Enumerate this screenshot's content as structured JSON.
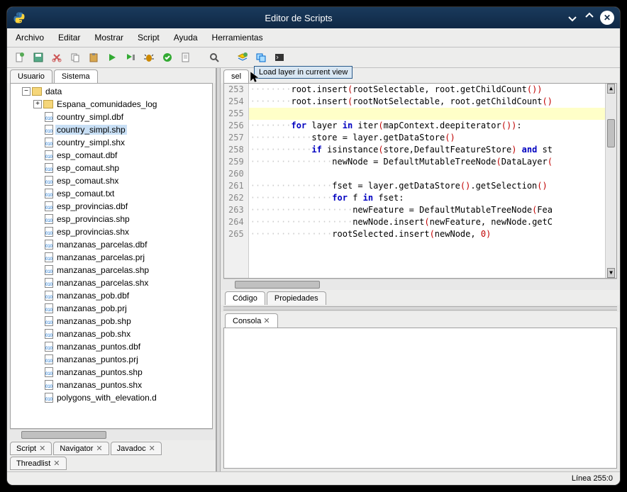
{
  "window": {
    "title": "Editor de Scripts"
  },
  "menu": {
    "items": [
      "Archivo",
      "Editar",
      "Mostrar",
      "Script",
      "Ayuda",
      "Herramientas"
    ]
  },
  "tooltip": "Load layer in current view",
  "leftTabs": {
    "top": [
      "Usuario",
      "Sistema"
    ],
    "activeTop": 1
  },
  "tree": {
    "root": "data",
    "subfolder": "Espana_comunidades_log",
    "files": [
      "country_simpl.dbf",
      "country_simpl.shp",
      "country_simpl.shx",
      "esp_comaut.dbf",
      "esp_comaut.shp",
      "esp_comaut.shx",
      "esp_comaut.txt",
      "esp_provincias.dbf",
      "esp_provincias.shp",
      "esp_provincias.shx",
      "manzanas_parcelas.dbf",
      "manzanas_parcelas.prj",
      "manzanas_parcelas.shp",
      "manzanas_parcelas.shx",
      "manzanas_pob.dbf",
      "manzanas_pob.prj",
      "manzanas_pob.shp",
      "manzanas_pob.shx",
      "manzanas_puntos.dbf",
      "manzanas_puntos.prj",
      "manzanas_puntos.shp",
      "manzanas_puntos.shx",
      "polygons_with_elevation.d"
    ],
    "selected": "country_simpl.shp"
  },
  "leftBottomTabs": [
    "Script",
    "Navigator",
    "Javadoc",
    "Threadlist"
  ],
  "codeTab": "sel",
  "gutterStart": 253,
  "gutterEnd": 265,
  "code": {
    "lines": [
      {
        "n": 253,
        "dots": 8,
        "t": [
          [
            "",
            "root.insert"
          ],
          [
            "paren",
            "("
          ],
          [
            "",
            "rootSelectable, root.getChildCount"
          ],
          [
            "paren",
            "())"
          ]
        ]
      },
      {
        "n": 254,
        "dots": 8,
        "t": [
          [
            "",
            "root.insert"
          ],
          [
            "paren",
            "("
          ],
          [
            "",
            "rootNotSelectable, root.getChildCount"
          ],
          [
            "paren",
            "()"
          ]
        ]
      },
      {
        "n": 255,
        "hl": true,
        "dots": 0,
        "t": []
      },
      {
        "n": 256,
        "dots": 8,
        "t": [
          [
            "kw",
            "for"
          ],
          [
            "",
            " layer "
          ],
          [
            "kw",
            "in"
          ],
          [
            "",
            " iter"
          ],
          [
            "paren",
            "("
          ],
          [
            "",
            "mapContext.deepiterator"
          ],
          [
            "paren",
            "())"
          ],
          [
            "",
            ":"
          ]
        ]
      },
      {
        "n": 257,
        "dots": 12,
        "t": [
          [
            "",
            "store = layer.getDataStore"
          ],
          [
            "paren",
            "()"
          ]
        ]
      },
      {
        "n": 258,
        "dots": 12,
        "t": [
          [
            "kw",
            "if"
          ],
          [
            "",
            " isinstance"
          ],
          [
            "paren",
            "("
          ],
          [
            "",
            "store,DefaultFeatureStore"
          ],
          [
            "paren",
            ")"
          ],
          [
            "",
            " "
          ],
          [
            "kw",
            "and"
          ],
          [
            "",
            " st"
          ]
        ]
      },
      {
        "n": 259,
        "dots": 16,
        "t": [
          [
            "",
            "newNode = DefaultMutableTreeNode"
          ],
          [
            "paren",
            "("
          ],
          [
            "",
            "DataLayer"
          ],
          [
            "paren",
            "("
          ]
        ]
      },
      {
        "n": 260,
        "dots": 0,
        "t": []
      },
      {
        "n": 261,
        "dots": 16,
        "t": [
          [
            "",
            "fset = layer.getDataStore"
          ],
          [
            "paren",
            "()"
          ],
          [
            "",
            ".getSelection"
          ],
          [
            "paren",
            "()"
          ]
        ]
      },
      {
        "n": 262,
        "dots": 16,
        "t": [
          [
            "kw",
            "for"
          ],
          [
            "",
            " f "
          ],
          [
            "kw",
            "in"
          ],
          [
            "",
            " fset:"
          ]
        ]
      },
      {
        "n": 263,
        "dots": 20,
        "t": [
          [
            "",
            "newFeature = DefaultMutableTreeNode"
          ],
          [
            "paren",
            "("
          ],
          [
            "",
            "Fea"
          ]
        ]
      },
      {
        "n": 264,
        "dots": 20,
        "t": [
          [
            "",
            "newNode.insert"
          ],
          [
            "paren",
            "("
          ],
          [
            "",
            "newFeature, newNode.getC"
          ]
        ]
      },
      {
        "n": 265,
        "dots": 16,
        "t": [
          [
            "",
            "rootSelected.insert"
          ],
          [
            "paren",
            "("
          ],
          [
            "",
            "newNode, "
          ],
          [
            "num",
            "0"
          ],
          [
            "paren",
            ")"
          ]
        ]
      }
    ]
  },
  "midTabs": [
    "Código",
    "Propiedades"
  ],
  "consoleTab": "Consola",
  "status": "Línea 255:0"
}
